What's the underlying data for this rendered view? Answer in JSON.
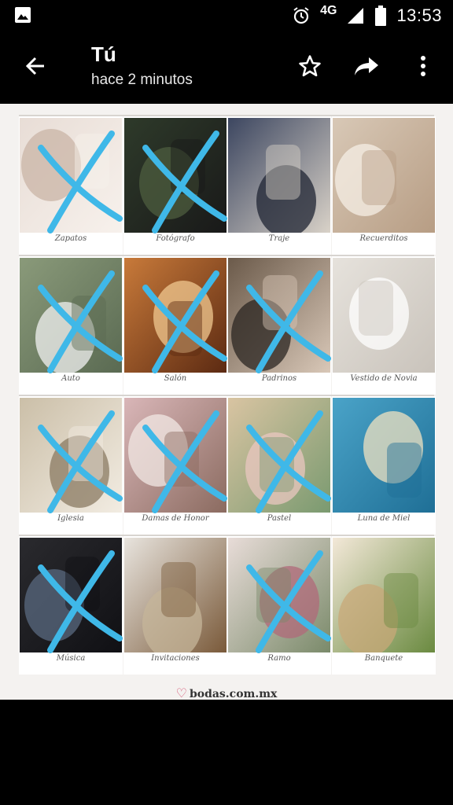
{
  "status": {
    "time": "13:53",
    "network": "4G"
  },
  "app_bar": {
    "title": "Tú",
    "subtitle": "hace 2 minutos",
    "icons": [
      "back-arrow-icon",
      "star-icon",
      "share-icon",
      "more-vert-icon"
    ]
  },
  "grid": {
    "labels": [
      "Zapatos",
      "Fotógrafo",
      "Traje",
      "Recuerditos",
      "Auto",
      "Salón",
      "Padrinos",
      "Vestido de Novia",
      "Iglesia",
      "Damas de Honor",
      "Pastel",
      "Luna de Miel",
      "Música",
      "Invitaciones",
      "Ramo",
      "Banquete"
    ],
    "crossed_out": [
      true,
      true,
      false,
      false,
      true,
      true,
      true,
      false,
      true,
      true,
      true,
      false,
      true,
      false,
      true,
      false
    ],
    "cross_color": "#3fb8e8"
  },
  "footer": {
    "brand": "bodas.com.mx"
  }
}
